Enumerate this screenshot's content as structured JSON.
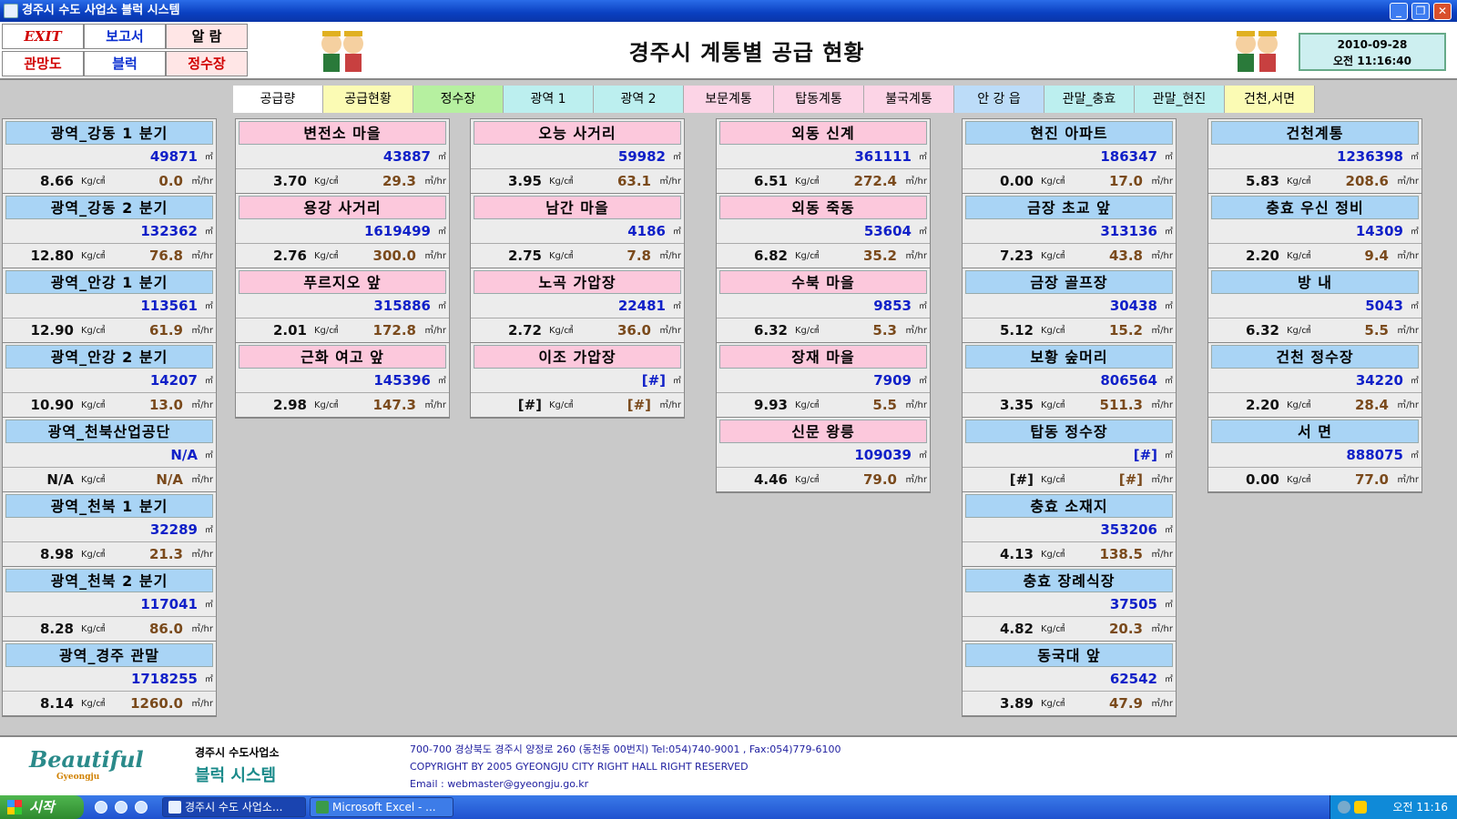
{
  "window": {
    "title": "경주시 수도 사업소 블럭 시스템"
  },
  "nav": {
    "exit": "EXIT",
    "report": "보고서",
    "alarm": "알 람",
    "pipe_map": "관망도",
    "block": "블럭",
    "plant": "정수장"
  },
  "header": {
    "title": "경주시 계통별 공급 현황",
    "date": "2010-09-28",
    "time": "오전 11:16:40"
  },
  "tabs": [
    {
      "label": "공급량",
      "color": "#ffffff"
    },
    {
      "label": "공급현황",
      "color": "#fbfbb4"
    },
    {
      "label": "정수장",
      "color": "#b6f0a0"
    },
    {
      "label": "광역 1",
      "color": "#bcefef"
    },
    {
      "label": "광역 2",
      "color": "#bcefef"
    },
    {
      "label": "보문계통",
      "color": "#fcd4e6"
    },
    {
      "label": "탑동계통",
      "color": "#fcd4e6"
    },
    {
      "label": "불국계통",
      "color": "#fcd4e6"
    },
    {
      "label": "안 강 읍",
      "color": "#bcdcf8"
    },
    {
      "label": "관말_충효",
      "color": "#bcefef"
    },
    {
      "label": "관말_현진",
      "color": "#bcefef"
    },
    {
      "label": "건천,서면",
      "color": "#fbfbb4"
    }
  ],
  "units": {
    "flow_total": "㎥",
    "pressure": "Kg/㎠",
    "flow_rate": "㎥/hr"
  },
  "columns": [
    {
      "head": "blue",
      "cards": [
        {
          "name": "광역_강동 1 분기",
          "total": "49871",
          "pressure": "8.66",
          "flow": "0.0"
        },
        {
          "name": "광역_강동 2 분기",
          "total": "132362",
          "pressure": "12.80",
          "flow": "76.8"
        },
        {
          "name": "광역_안강 1 분기",
          "total": "113561",
          "pressure": "12.90",
          "flow": "61.9"
        },
        {
          "name": "광역_안강 2 분기",
          "total": "14207",
          "pressure": "10.90",
          "flow": "13.0"
        },
        {
          "name": "광역_천북산업공단",
          "total": "N/A",
          "pressure": "N/A",
          "flow": "N/A"
        },
        {
          "name": "광역_천북 1 분기",
          "total": "32289",
          "pressure": "8.98",
          "flow": "21.3"
        },
        {
          "name": "광역_천북 2 분기",
          "total": "117041",
          "pressure": "8.28",
          "flow": "86.0"
        },
        {
          "name": "광역_경주 관말",
          "total": "1718255",
          "pressure": "8.14",
          "flow": "1260.0"
        }
      ]
    },
    {
      "head": "pink",
      "cards": [
        {
          "name": "변전소 마을",
          "total": "43887",
          "pressure": "3.70",
          "flow": "29.3"
        },
        {
          "name": "용강 사거리",
          "total": "1619499",
          "pressure": "2.76",
          "flow": "300.0"
        },
        {
          "name": "푸르지오 앞",
          "total": "315886",
          "pressure": "2.01",
          "flow": "172.8"
        },
        {
          "name": "근화 여고 앞",
          "total": "145396",
          "pressure": "2.98",
          "flow": "147.3"
        }
      ]
    },
    {
      "head": "pink",
      "cards": [
        {
          "name": "오능 사거리",
          "total": "59982",
          "pressure": "3.95",
          "flow": "63.1"
        },
        {
          "name": "남간 마을",
          "total": "4186",
          "pressure": "2.75",
          "flow": "7.8"
        },
        {
          "name": "노곡 가압장",
          "total": "22481",
          "pressure": "2.72",
          "flow": "36.0"
        },
        {
          "name": "이조 가압장",
          "total": "[#]",
          "pressure": "[#]",
          "flow": "[#]"
        }
      ]
    },
    {
      "head": "pink",
      "cards": [
        {
          "name": "외동 신계",
          "total": "361111",
          "pressure": "6.51",
          "flow": "272.4"
        },
        {
          "name": "외동 죽동",
          "total": "53604",
          "pressure": "6.82",
          "flow": "35.2"
        },
        {
          "name": "수북 마을",
          "total": "9853",
          "pressure": "6.32",
          "flow": "5.3"
        },
        {
          "name": "장재 마을",
          "total": "7909",
          "pressure": "9.93",
          "flow": "5.5"
        },
        {
          "name": "신문 왕릉",
          "total": "109039",
          "pressure": "4.46",
          "flow": "79.0"
        }
      ]
    },
    {
      "head": "blue",
      "cards": [
        {
          "name": "현진 아파트",
          "total": "186347",
          "pressure": "0.00",
          "flow": "17.0"
        },
        {
          "name": "금장 초교 앞",
          "total": "313136",
          "pressure": "7.23",
          "flow": "43.8"
        },
        {
          "name": "금장 골프장",
          "total": "30438",
          "pressure": "5.12",
          "flow": "15.2"
        },
        {
          "name": "보황 숲머리",
          "total": "806564",
          "pressure": "3.35",
          "flow": "511.3"
        },
        {
          "name": "탑동 정수장",
          "total": "[#]",
          "pressure": "[#]",
          "flow": "[#]"
        },
        {
          "name": "충효 소재지",
          "total": "353206",
          "pressure": "4.13",
          "flow": "138.5"
        },
        {
          "name": "충효 장례식장",
          "total": "37505",
          "pressure": "4.82",
          "flow": "20.3"
        },
        {
          "name": "동국대 앞",
          "total": "62542",
          "pressure": "3.89",
          "flow": "47.9"
        }
      ]
    },
    {
      "head": "blue",
      "cards": [
        {
          "name": "건천계통",
          "total": "1236398",
          "pressure": "5.83",
          "flow": "208.6"
        },
        {
          "name": "충효 우신 정비",
          "total": "14309",
          "pressure": "2.20",
          "flow": "9.4"
        },
        {
          "name": "방 내",
          "total": "5043",
          "pressure": "6.32",
          "flow": "5.5"
        },
        {
          "name": "건천 정수장",
          "total": "34220",
          "pressure": "2.20",
          "flow": "28.4"
        },
        {
          "name": "서 면",
          "total": "888075",
          "pressure": "0.00",
          "flow": "77.0"
        }
      ]
    }
  ],
  "footer": {
    "logo_text": "Beautiful",
    "logo_sub": "Gyeongju",
    "org": "경주시 수도사업소",
    "system": "블럭 시스템",
    "address": "700-700 경상북도 경주시 양정로 260 (동천동 00번지) Tel:054)740-9001 , Fax:054)779-6100",
    "copyright": "COPYRIGHT BY 2005 GYEONGJU CITY RIGHT HALL RIGHT RESERVED",
    "email": "Email : webmaster@gyeongju.go.kr"
  },
  "taskbar": {
    "start": "시작",
    "tasks": [
      "경주시 수도 사업소...",
      "Microsoft Excel - ..."
    ],
    "clock": "오전 11:16"
  }
}
